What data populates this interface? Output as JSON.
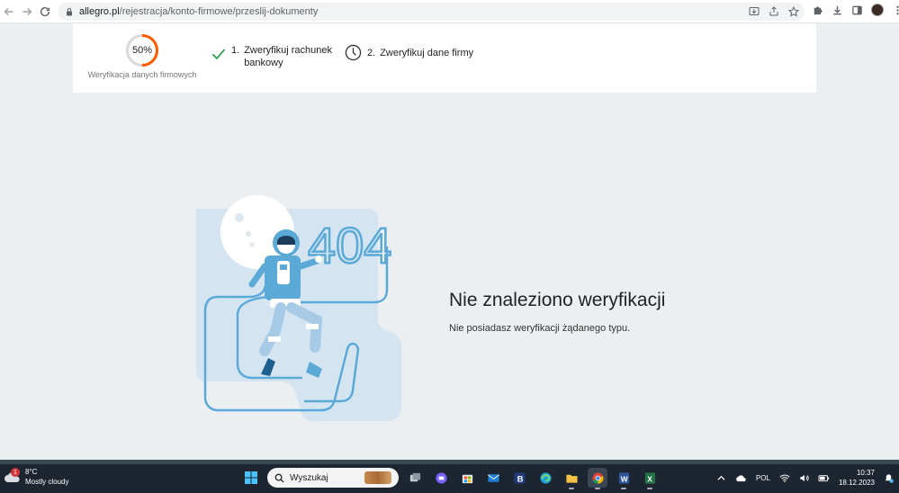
{
  "browser": {
    "url_host": "allegro.pl",
    "url_path": "/rejestracja/konto-firmowe/przeslij-dokumenty"
  },
  "progress": {
    "value": "50%",
    "fraction": 0.5,
    "caption": "Weryfikacja danych firmowych",
    "color": "#ff5a00"
  },
  "steps": [
    {
      "num": "1.",
      "label": "Zweryfikuj rachunek bankowy",
      "status": "done",
      "icon": "check-icon"
    },
    {
      "num": "2.",
      "label": "Zweryfikuj dane firmy",
      "status": "pending",
      "icon": "clock-icon"
    }
  ],
  "error": {
    "title": "Nie znaleziono weryfikacji",
    "description": "Nie posiadasz weryfikacji żądanego typu.",
    "illustration_text": "404"
  },
  "taskbar": {
    "weather_temp": "8°C",
    "weather_desc": "Mostly cloudy",
    "weather_badge": "1",
    "search_placeholder": "Wyszukaj",
    "language": "POL",
    "time": "10:37",
    "date": "18.12.2023"
  },
  "colors": {
    "accent": "#ff5a00",
    "check": "#1a9b3f",
    "illustration_blue": "#5aa9d6",
    "illustration_light": "#d4e5f1"
  }
}
